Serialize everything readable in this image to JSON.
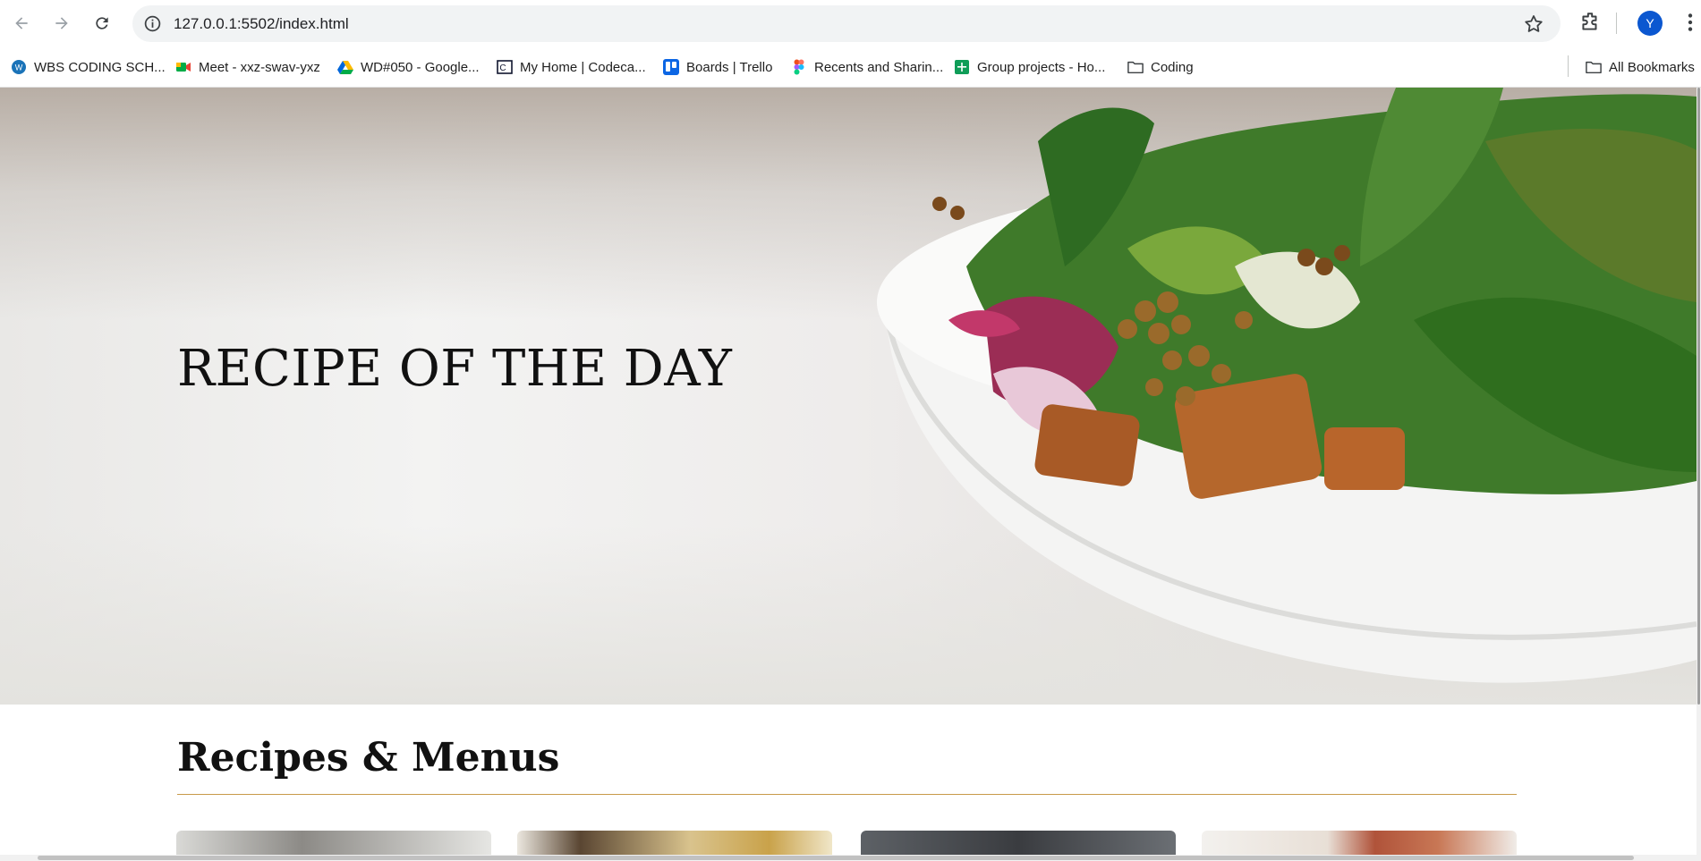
{
  "browser": {
    "url": "127.0.0.1:5502/index.html",
    "profile_initial": "Y",
    "bookmarks": [
      {
        "label": "WBS CODING SCH...",
        "icon": "wbs-favicon"
      },
      {
        "label": "Meet - xxz-swav-yxz",
        "icon": "google-meet-favicon"
      },
      {
        "label": "WD#050 - Google...",
        "icon": "google-drive-favicon"
      },
      {
        "label": "My Home | Codeca...",
        "icon": "codecademy-favicon"
      },
      {
        "label": "Boards | Trello",
        "icon": "trello-favicon"
      },
      {
        "label": "Recents and Sharin...",
        "icon": "figma-favicon"
      },
      {
        "label": "Group projects - Ho...",
        "icon": "google-sheets-favicon"
      },
      {
        "label": "Coding",
        "icon": "folder-icon"
      }
    ],
    "all_bookmarks_label": "All Bookmarks",
    "colors": {
      "profile": "#0b57d0",
      "omnibox": "#f1f3f4"
    }
  },
  "page": {
    "hero_title": "RECIPE OF THE DAY",
    "section_title": "Recipes & Menus",
    "accent_rule_color": "#c89a4a",
    "cards": [
      "card-1-image",
      "card-2-image",
      "card-3-image",
      "card-4-image"
    ]
  }
}
